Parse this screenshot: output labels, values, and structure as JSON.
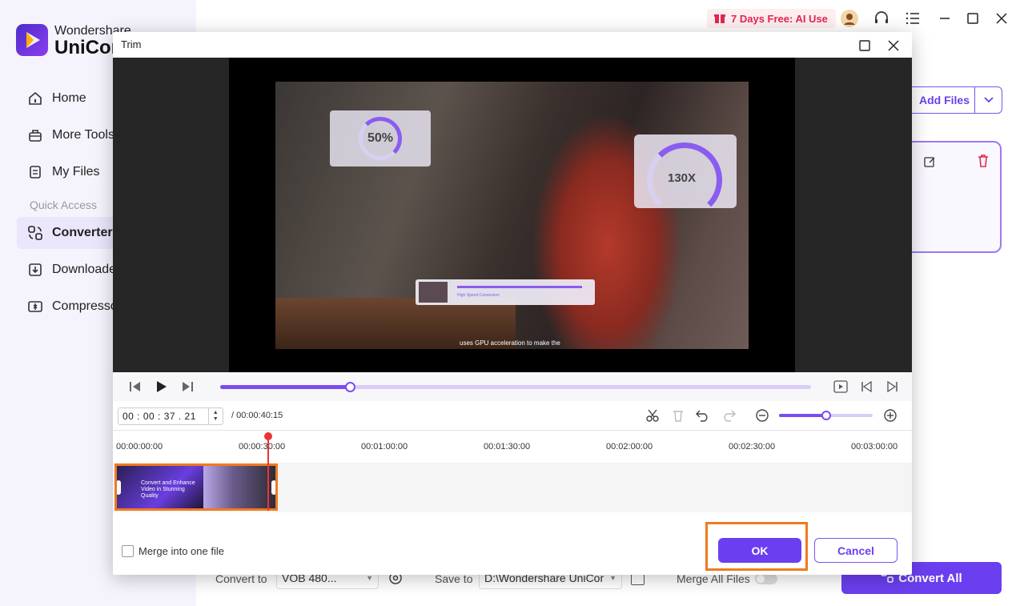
{
  "app": {
    "brand_top": "Wondershare",
    "brand_main": "UniCon"
  },
  "sidebar": {
    "items": [
      {
        "label": "Home",
        "icon": "home-icon"
      },
      {
        "label": "More Tools",
        "icon": "toolbox-icon"
      },
      {
        "label": "My Files",
        "icon": "file-icon"
      }
    ],
    "quick_access_label": "Quick Access",
    "quick_items": [
      {
        "label": "Converter",
        "icon": "converter-icon",
        "active": true
      },
      {
        "label": "Downloade",
        "icon": "download-icon"
      },
      {
        "label": "Compresso",
        "icon": "compress-icon"
      }
    ]
  },
  "topbar": {
    "promo": "7 Days Free: AI Use"
  },
  "main": {
    "add_files": "Add Files"
  },
  "bottom": {
    "convert_to_label": "Convert to",
    "convert_to_value": "VOB 480...",
    "save_to_label": "Save to",
    "save_to_value": "D:\\Wondershare UniCor",
    "merge_all_label": "Merge All Files",
    "convert_all": "Convert All"
  },
  "dialog": {
    "title": "Trim",
    "overlay_percent": "50%",
    "overlay_speed": "130X",
    "overlay_caption": "High Speed Conversion",
    "subtitle": "uses GPU acceleration to make the",
    "playback_progress": 0.22,
    "current_time": "00 : 00 : 37 . 21",
    "duration": "/ 00:00:40:15",
    "zoom_level": 0.5,
    "ruler_ticks": [
      "00:00:00:00",
      "00:00:30:00",
      "00:01:00:00",
      "00:01:30:00",
      "00:02:00:00",
      "00:02:30:00",
      "00:03:00:00"
    ],
    "clip_text": "Convert and Enhance Video in Stunning Quality",
    "merge_label": "Merge into one file",
    "ok": "OK",
    "cancel": "Cancel"
  },
  "colors": {
    "accent": "#6b3ff0",
    "highlight": "#f07a1f",
    "playhead": "#e33333"
  }
}
